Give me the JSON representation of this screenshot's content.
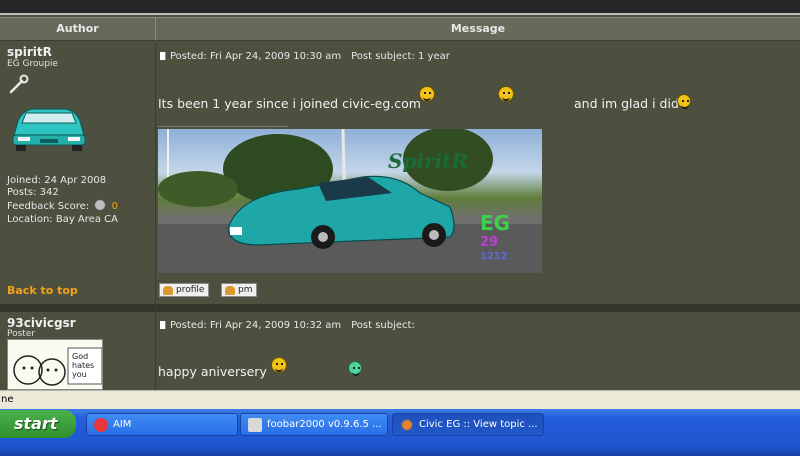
{
  "header": {
    "author": "Author",
    "message": "Message"
  },
  "posts": [
    {
      "username": "spiritR",
      "rank": "EG Groupie",
      "joined": "Joined: 24 Apr 2008",
      "posts": "Posts: 342",
      "feedback_label": "Feedback Score:",
      "feedback_value": "0",
      "location": "Location: Bay Area CA",
      "posted": "Posted: Fri Apr 24, 2009 10:30 am",
      "subject": "Post subject: 1 year",
      "text_a": "Its been 1 year since i joined civic-eg.com",
      "text_b": "and im glad i did",
      "back_to_top": "Back to top",
      "profile_label": "profile",
      "pm_label": "pm",
      "sig_logo": "SpiritR",
      "sig_tag": "EG",
      "sig_nums": "29",
      "sig_nums2": "1212"
    },
    {
      "username": "93civicgsr",
      "rank": "Poster",
      "posted": "Posted: Fri Apr 24, 2009 10:32 am",
      "subject": "Post subject:",
      "text": "happy aniversery",
      "avatar_text": "God hates you"
    }
  ],
  "statusbar": {
    "text": "ne"
  },
  "taskbar": {
    "start": "start",
    "tasks": [
      {
        "label": "AIM"
      },
      {
        "label": "foobar2000 v0.9.6.5 ..."
      },
      {
        "label": "Civic EG :: View topic ..."
      }
    ]
  }
}
